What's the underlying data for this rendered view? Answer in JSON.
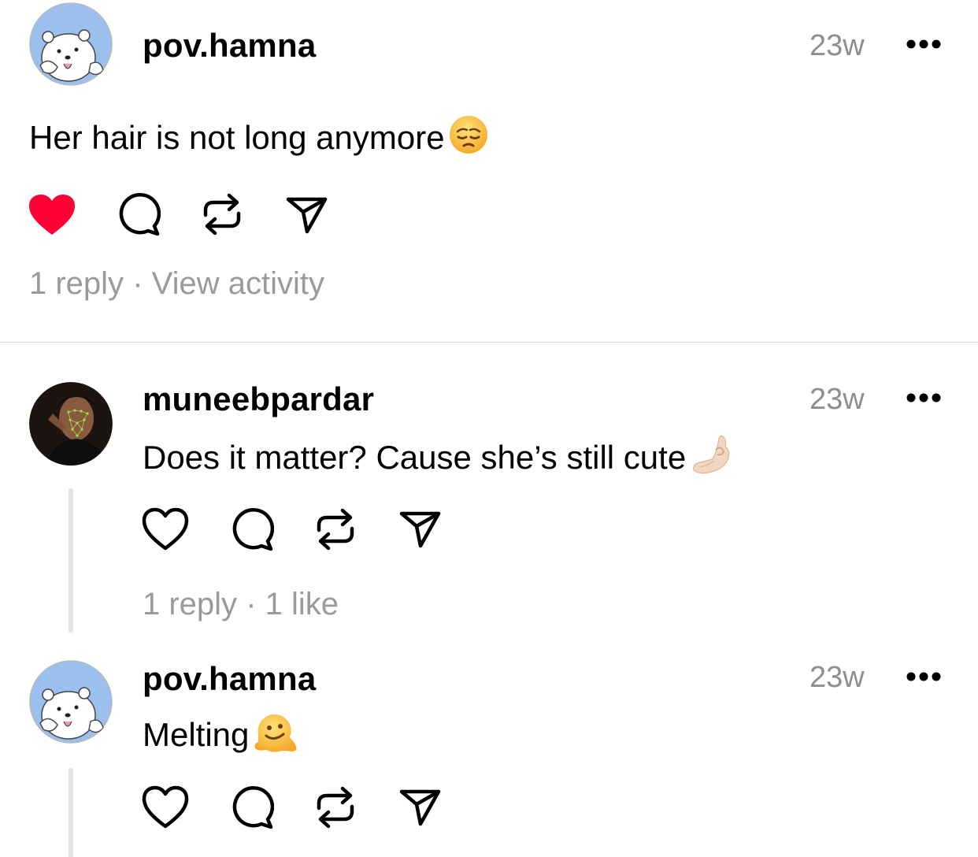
{
  "main_post": {
    "username": "pov.hamna",
    "time": "23w",
    "text": "Her hair is not long anymore",
    "emoji": "pensive-face-emoji",
    "liked": true,
    "replies_label": "1 reply",
    "separator": "·",
    "activity_label": "View activity"
  },
  "reply_1": {
    "username": "muneebpardar",
    "time": "23w",
    "text": "Does it matter? Cause she’s still cute",
    "emoji": "pinching-hand-emoji",
    "liked": false,
    "replies_label": "1 reply",
    "separator": "·",
    "likes_label": "1 like"
  },
  "reply_2": {
    "username": "pov.hamna",
    "time": "23w",
    "text": "Melting",
    "emoji": "melting-face-emoji",
    "liked": false
  },
  "colors": {
    "like_active": "#ff0034",
    "muted_text": "#8e8e8e",
    "avatar_blue": "#9cc0ee"
  }
}
